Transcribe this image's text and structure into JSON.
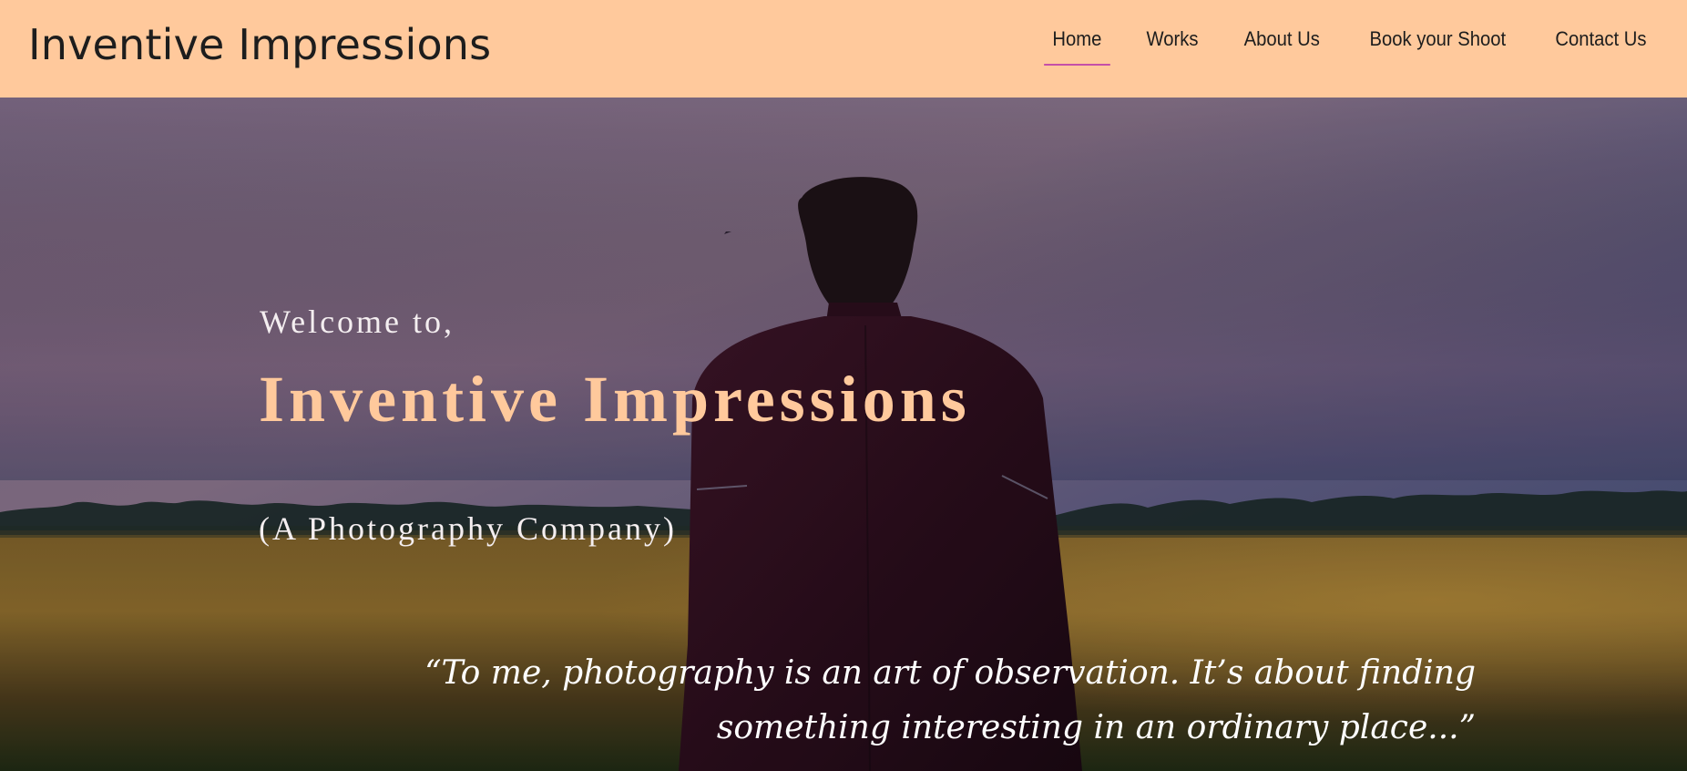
{
  "header": {
    "brand": "Inventive Impressions",
    "nav": [
      {
        "label": "Home",
        "active": true
      },
      {
        "label": "Works"
      },
      {
        "label": "About Us"
      },
      {
        "label": "Book your Shoot"
      },
      {
        "label": "Contact Us"
      }
    ]
  },
  "hero": {
    "welcome": "Welcome to,",
    "title": "Inventive Impressions",
    "subtitle": "(A Photography Company)",
    "quote": "“To me, photography is an art of observation. It’s about finding something interesting in an ordinary place...”"
  },
  "colors": {
    "header_bg": "#ffc99c",
    "accent_underline": "#c54fa8",
    "title_color": "#ffc99c"
  }
}
